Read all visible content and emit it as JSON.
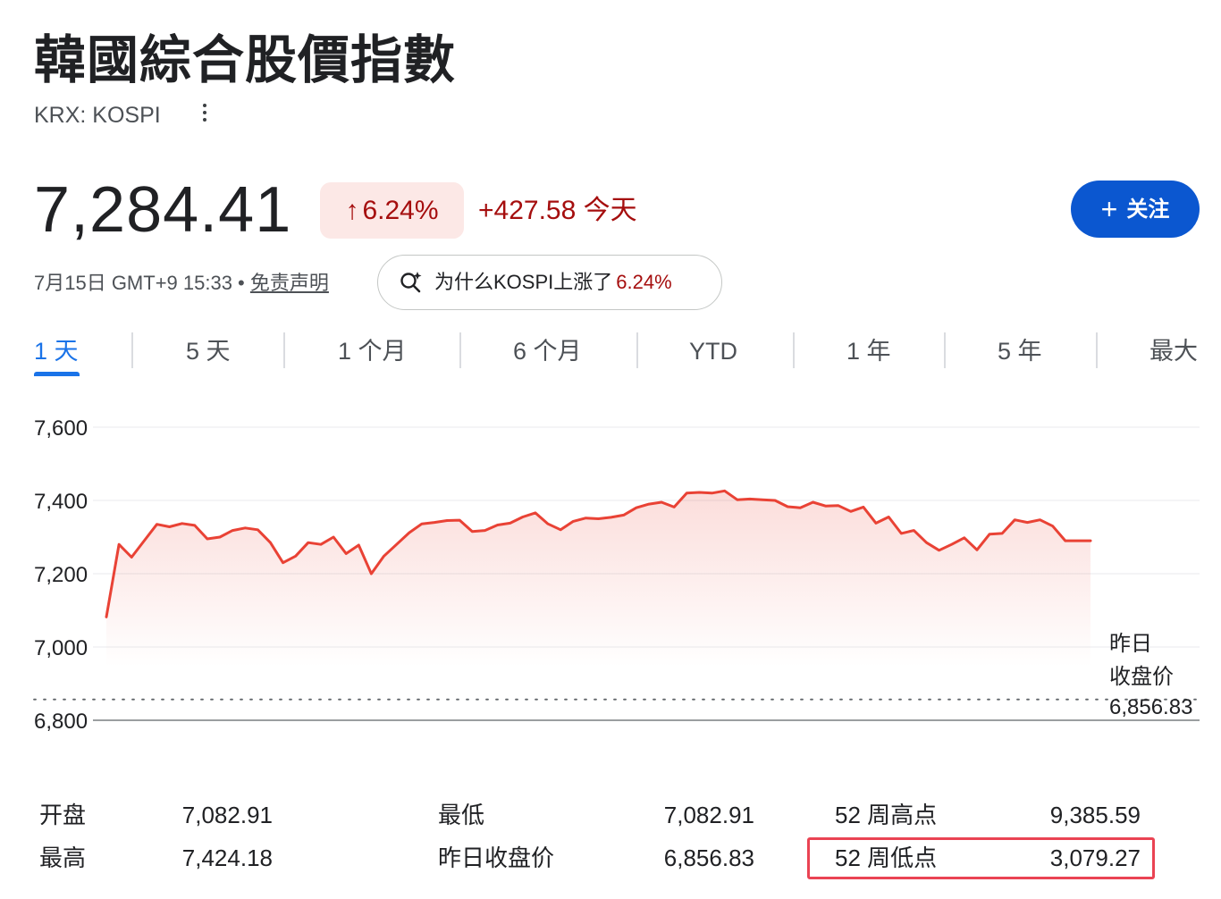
{
  "header": {
    "title": "韓國綜合股價指數",
    "ticker": "KRX: KOSPI"
  },
  "quote": {
    "price": "7,284.41",
    "change_percent": "6.24%",
    "change_arrow_icon": "arrow-up-icon",
    "change_absolute": "+427.58 今天",
    "follow_label": "关注",
    "follow_icon": "plus-icon"
  },
  "meta": {
    "timestamp": "7月15日 GMT+9 15:33 •",
    "disclaimer": "免责声明"
  },
  "why_chip": {
    "icon": "sparkle-search-icon",
    "text": "为什么KOSPI上涨了",
    "percent": "6.24%"
  },
  "tabs": [
    {
      "label": "1 天",
      "active": true
    },
    {
      "label": "5 天",
      "active": false
    },
    {
      "label": "1 个月",
      "active": false
    },
    {
      "label": "6 个月",
      "active": false
    },
    {
      "label": "YTD",
      "active": false
    },
    {
      "label": "1 年",
      "active": false
    },
    {
      "label": "5 年",
      "active": false
    },
    {
      "label": "最大",
      "active": false
    }
  ],
  "chart_data": {
    "type": "area",
    "ylim": [
      6800,
      7600
    ],
    "yticks": [
      "7,600",
      "7,400",
      "7,200",
      "7,000",
      "6,800"
    ],
    "ytick_values": [
      7600,
      7400,
      7200,
      7000,
      6800
    ],
    "previous_close": 6856.83,
    "previous_close_label": [
      "昨日",
      "收盘价"
    ],
    "previous_close_text": "6,856.83",
    "line_color": "#e94235",
    "values": [
      7082,
      7280,
      7245,
      7290,
      7335,
      7328,
      7337,
      7332,
      7295,
      7300,
      7318,
      7325,
      7320,
      7285,
      7230,
      7248,
      7285,
      7280,
      7300,
      7255,
      7278,
      7200,
      7248,
      7280,
      7312,
      7336,
      7340,
      7345,
      7346,
      7315,
      7318,
      7333,
      7338,
      7355,
      7366,
      7336,
      7320,
      7343,
      7352,
      7350,
      7354,
      7360,
      7380,
      7390,
      7395,
      7382,
      7420,
      7422,
      7420,
      7426,
      7402,
      7404,
      7402,
      7400,
      7383,
      7380,
      7395,
      7385,
      7386,
      7370,
      7382,
      7338,
      7355,
      7310,
      7318,
      7285,
      7264,
      7280,
      7298,
      7265,
      7308,
      7310,
      7347,
      7340,
      7347,
      7330,
      7290,
      7290,
      7290
    ]
  },
  "stats": [
    {
      "label": "开盘",
      "value": "7,082.91"
    },
    {
      "label": "最高",
      "value": "7,424.18"
    },
    {
      "label": "最低",
      "value": "7,082.91"
    },
    {
      "label": "昨日收盘价",
      "value": "6,856.83"
    },
    {
      "label": "52 周高点",
      "value": "9,385.59"
    },
    {
      "label": "52 周低点",
      "value": "3,079.27"
    }
  ],
  "colors": {
    "up_red": "#a50e0e",
    "up_red_bg": "#fce8e6",
    "accent_blue": "#0b57d0",
    "tab_active": "#1a73e8",
    "highlight_box": "#ea4353"
  }
}
